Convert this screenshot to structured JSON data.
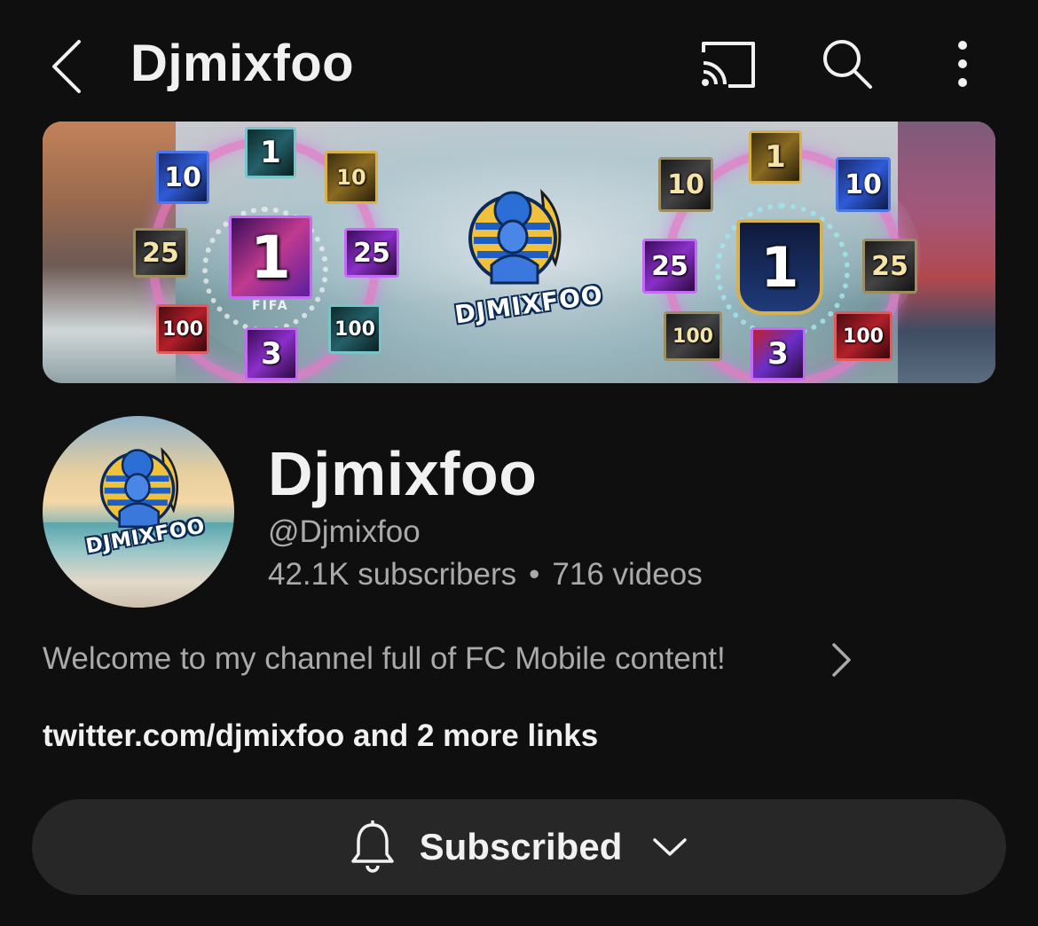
{
  "header": {
    "title": "Djmixfoo",
    "icons": {
      "back": "chevron-left-icon",
      "cast": "cast-icon",
      "search": "search-icon",
      "more": "more-vertical-icon"
    }
  },
  "banner": {
    "left_badges": [
      "10",
      "1",
      "10",
      "25",
      "1",
      "25",
      "100",
      "3",
      "100"
    ],
    "center_logo_text": "DJMIXFOO",
    "right_badges": [
      "10",
      "1",
      "10",
      "25",
      "1",
      "25",
      "100",
      "3",
      "100"
    ],
    "fifa_text": "FIFA"
  },
  "channel": {
    "avatar_logo_text": "DJMIXFOO",
    "name": "Djmixfoo",
    "handle": "@Djmixfoo",
    "subscribers": "42.1K subscribers",
    "separator": "•",
    "videos": "716 videos",
    "description": "Welcome to my channel full of FC Mobile content!",
    "links": "twitter.com/djmixfoo and 2 more links"
  },
  "subscribe": {
    "label": "Subscribed",
    "icon": "bell-icon",
    "chevron": "chevron-down-icon"
  },
  "colors": {
    "background": "#0f0f0f",
    "primary_text": "#f1f1f1",
    "secondary_text": "#aaaaaa",
    "button_bg": "#272727"
  }
}
